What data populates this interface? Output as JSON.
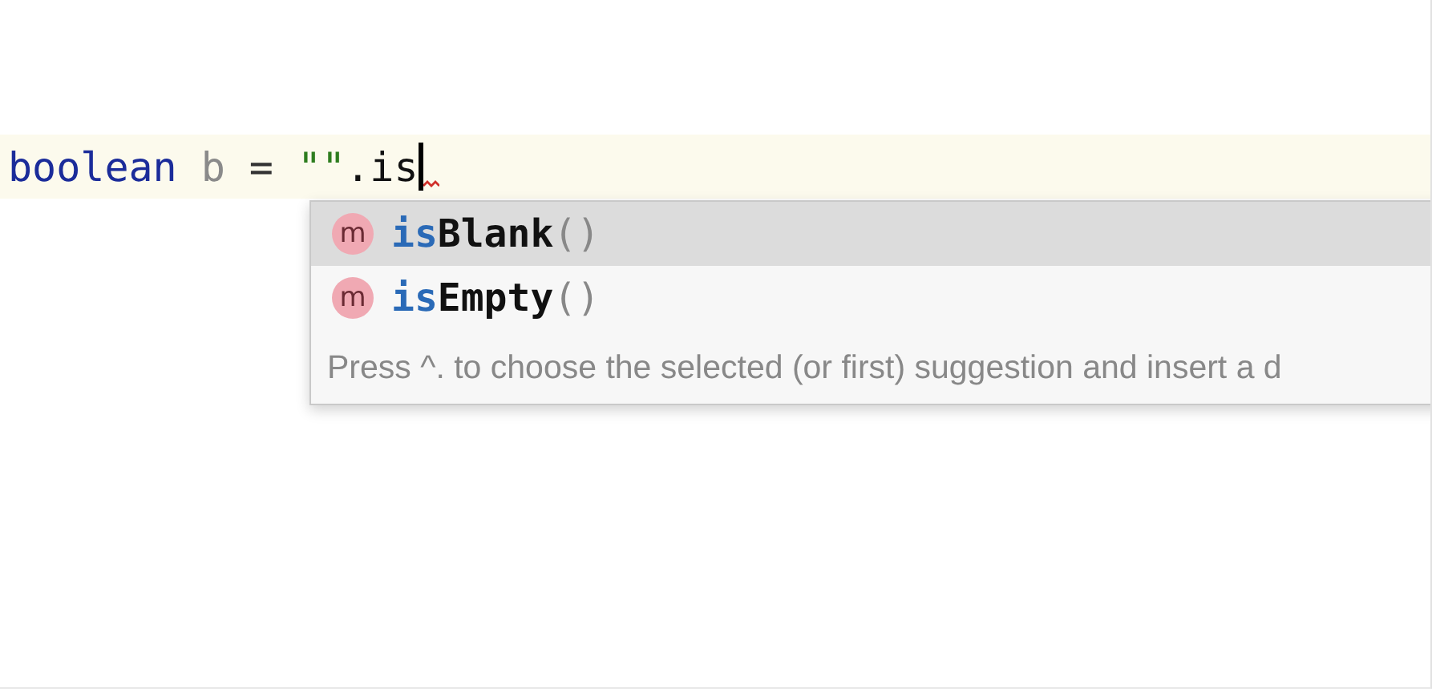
{
  "editor": {
    "code_line": [
      {
        "kind": "keyword",
        "text": "boolean"
      },
      {
        "kind": "variable",
        "text": "b"
      },
      {
        "kind": "operator",
        "text": "="
      },
      {
        "kind": "string",
        "text": "\"\""
      },
      {
        "kind": "plain",
        "text": ".is"
      }
    ],
    "error_mark": true
  },
  "completion": {
    "items": [
      {
        "icon": "m",
        "match": "is",
        "rest": "Blank",
        "params": "()",
        "selected": true
      },
      {
        "icon": "m",
        "match": "is",
        "rest": "Empty",
        "params": "()",
        "selected": false
      }
    ],
    "hint": "Press ^. to choose the selected (or first) suggestion and insert a d"
  }
}
